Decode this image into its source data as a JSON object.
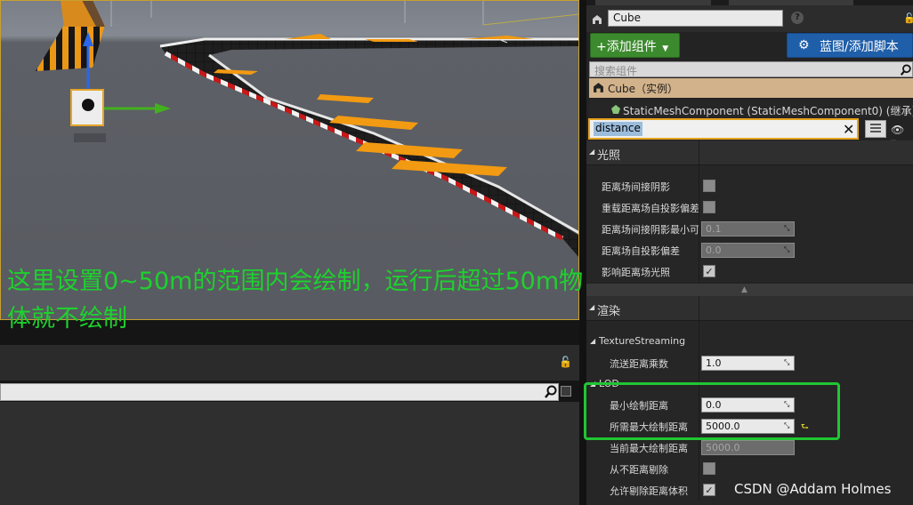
{
  "annotation": {
    "line1": "这里设置0~50m的范围内会绘制，运行后超过50m物",
    "line2": "体就不绘制"
  },
  "details": {
    "actor_name": "Cube",
    "add_component_label": "+添加组件",
    "blueprint_label": "蓝图/添加脚本",
    "component_search_placeholder": "搜索组件",
    "root_component": "Cube（实例）",
    "child_component": "StaticMeshComponent (StaticMeshComponent0) (继承)",
    "details_search_value": "distance",
    "categories": {
      "lighting": "光照",
      "rendering": "渲染",
      "texture_streaming": "TextureStreaming",
      "lod": "LOD"
    },
    "lighting_props": [
      {
        "label": "距离场间接阴影",
        "checked": false
      },
      {
        "label": "重载距离场自投影偏差",
        "checked": false
      },
      {
        "label": "距离场间接阴影最小可",
        "value": "0.1"
      },
      {
        "label": "距离场自投影偏差",
        "value": "0.0"
      },
      {
        "label": "影响距离场光照",
        "checked": true
      }
    ],
    "streaming_props": [
      {
        "label": "流送距离乘数",
        "value": "1.0"
      }
    ],
    "lod_props": [
      {
        "label": "最小绘制距离",
        "value": "0.0"
      },
      {
        "label": "所需最大绘制距离",
        "value": "5000.0"
      },
      {
        "label": "当前最大绘制距离",
        "value": "5000.0"
      },
      {
        "label": "从不距离剔除",
        "checked": false
      },
      {
        "label": "允许剔除距离体积",
        "checked": true
      }
    ]
  },
  "watermark": "CSDN @Addam Holmes",
  "colors": {
    "annotation": "#1ed12e",
    "highlight_box": "#1fc632",
    "add_button": "#3c8a2e",
    "blueprint_button": "#1f5ea8",
    "search_outline": "#e6a21d"
  },
  "icons": {
    "actor": "actor-icon",
    "help": "help-icon",
    "lock": "lock-icon",
    "gear": "gear-icon",
    "search": "search-icon",
    "clear": "close-icon",
    "view_options": "eye-icon",
    "grid": "grid-icon"
  }
}
